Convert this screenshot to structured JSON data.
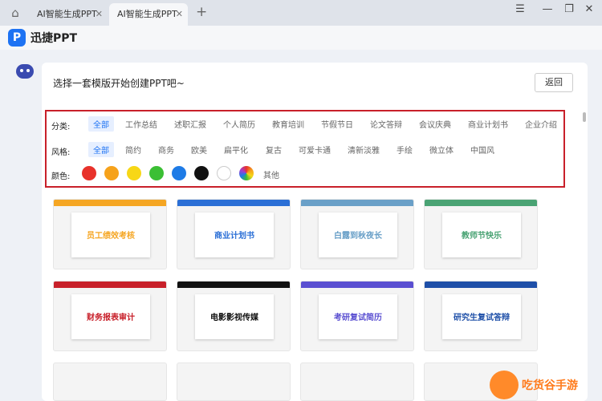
{
  "tabs": [
    {
      "label": "AI智能生成PPT"
    },
    {
      "label": "AI智能生成PPT"
    }
  ],
  "app": {
    "logo_letter": "P",
    "name": "迅捷PPT"
  },
  "panel": {
    "title": "选择一套模版开始创建PPT吧~",
    "back_label": "返回"
  },
  "filters": {
    "category": {
      "label": "分类:",
      "options": [
        "全部",
        "工作总结",
        "述职汇报",
        "个人简历",
        "教育培训",
        "节假节日",
        "论文答辩",
        "会议庆典",
        "商业计划书",
        "企业介绍"
      ]
    },
    "style": {
      "label": "风格:",
      "options": [
        "全部",
        "简约",
        "商务",
        "欧美",
        "扁平化",
        "复古",
        "可爱卡通",
        "清新淡雅",
        "手绘",
        "微立体",
        "中国风"
      ]
    },
    "color": {
      "label": "颜色:",
      "swatches": [
        "#e8322b",
        "#f6a21b",
        "#f7d716",
        "#3bbf34",
        "#1e7be6",
        "#111111",
        "#ffffff",
        "rainbow"
      ],
      "other_label": "其他"
    }
  },
  "templates": [
    {
      "title": "员工绩效考核",
      "accent": "#f5a623"
    },
    {
      "title": "商业计划书",
      "accent": "#2b6fd6"
    },
    {
      "title": "白露到秋夜长",
      "accent": "#6aa0c8"
    },
    {
      "title": "教师节快乐",
      "accent": "#4aa374"
    },
    {
      "title": "财务报表审计",
      "accent": "#c8202a"
    },
    {
      "title": "电影影视传媒",
      "accent": "#111111"
    },
    {
      "title": "考研复试简历",
      "accent": "#5a4fd1"
    },
    {
      "title": "研究生复试答辩",
      "accent": "#1e4fa8"
    }
  ],
  "watermark": {
    "text": "吃货谷手游"
  }
}
